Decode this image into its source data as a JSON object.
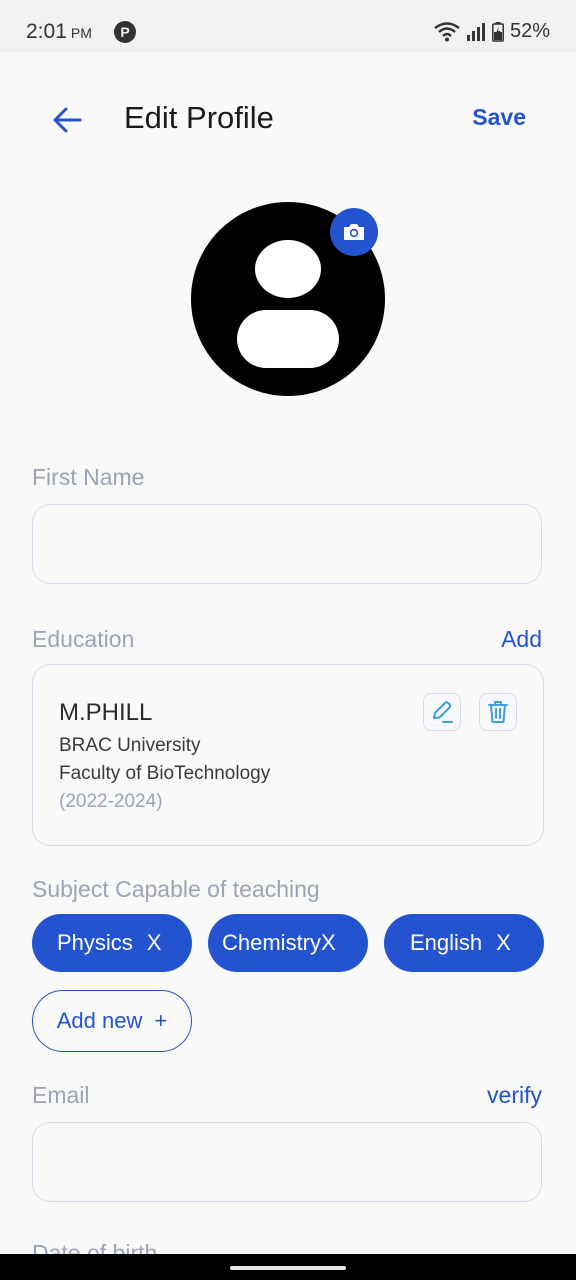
{
  "status_bar": {
    "time": "2:01",
    "ampm": "PM",
    "app_icon_letter": "P",
    "battery": "52%"
  },
  "header": {
    "title": "Edit Profile",
    "save_label": "Save"
  },
  "form": {
    "first_name": {
      "label": "First Name",
      "value": "",
      "placeholder": ""
    },
    "education": {
      "label": "Education",
      "add_label": "Add",
      "items": [
        {
          "degree": "M.PHILL",
          "school": "BRAC University",
          "faculty": "Faculty of BioTechnology",
          "years": "(2022-2024)"
        }
      ]
    },
    "subjects": {
      "label": "Subject Capable of teaching",
      "chips": [
        {
          "label": "Physics",
          "remove": "X"
        },
        {
          "label": "Chemistry",
          "remove": "X"
        },
        {
          "label": "English",
          "remove": "X"
        }
      ],
      "add_new_label": "Add new",
      "add_new_symbol": "+"
    },
    "email": {
      "label": "Email",
      "verify_label": "verify",
      "value": "",
      "placeholder": ""
    },
    "date_of_birth": {
      "label": "Date of birth"
    }
  },
  "colors": {
    "accent": "#2453cf",
    "label_gray": "#9aa4b8",
    "border": "#d4dbeb",
    "background": "#f9f9fa"
  },
  "icons": {
    "back": "arrow-left-icon",
    "camera": "camera-icon",
    "edit": "pencil-icon",
    "delete": "trash-icon"
  }
}
